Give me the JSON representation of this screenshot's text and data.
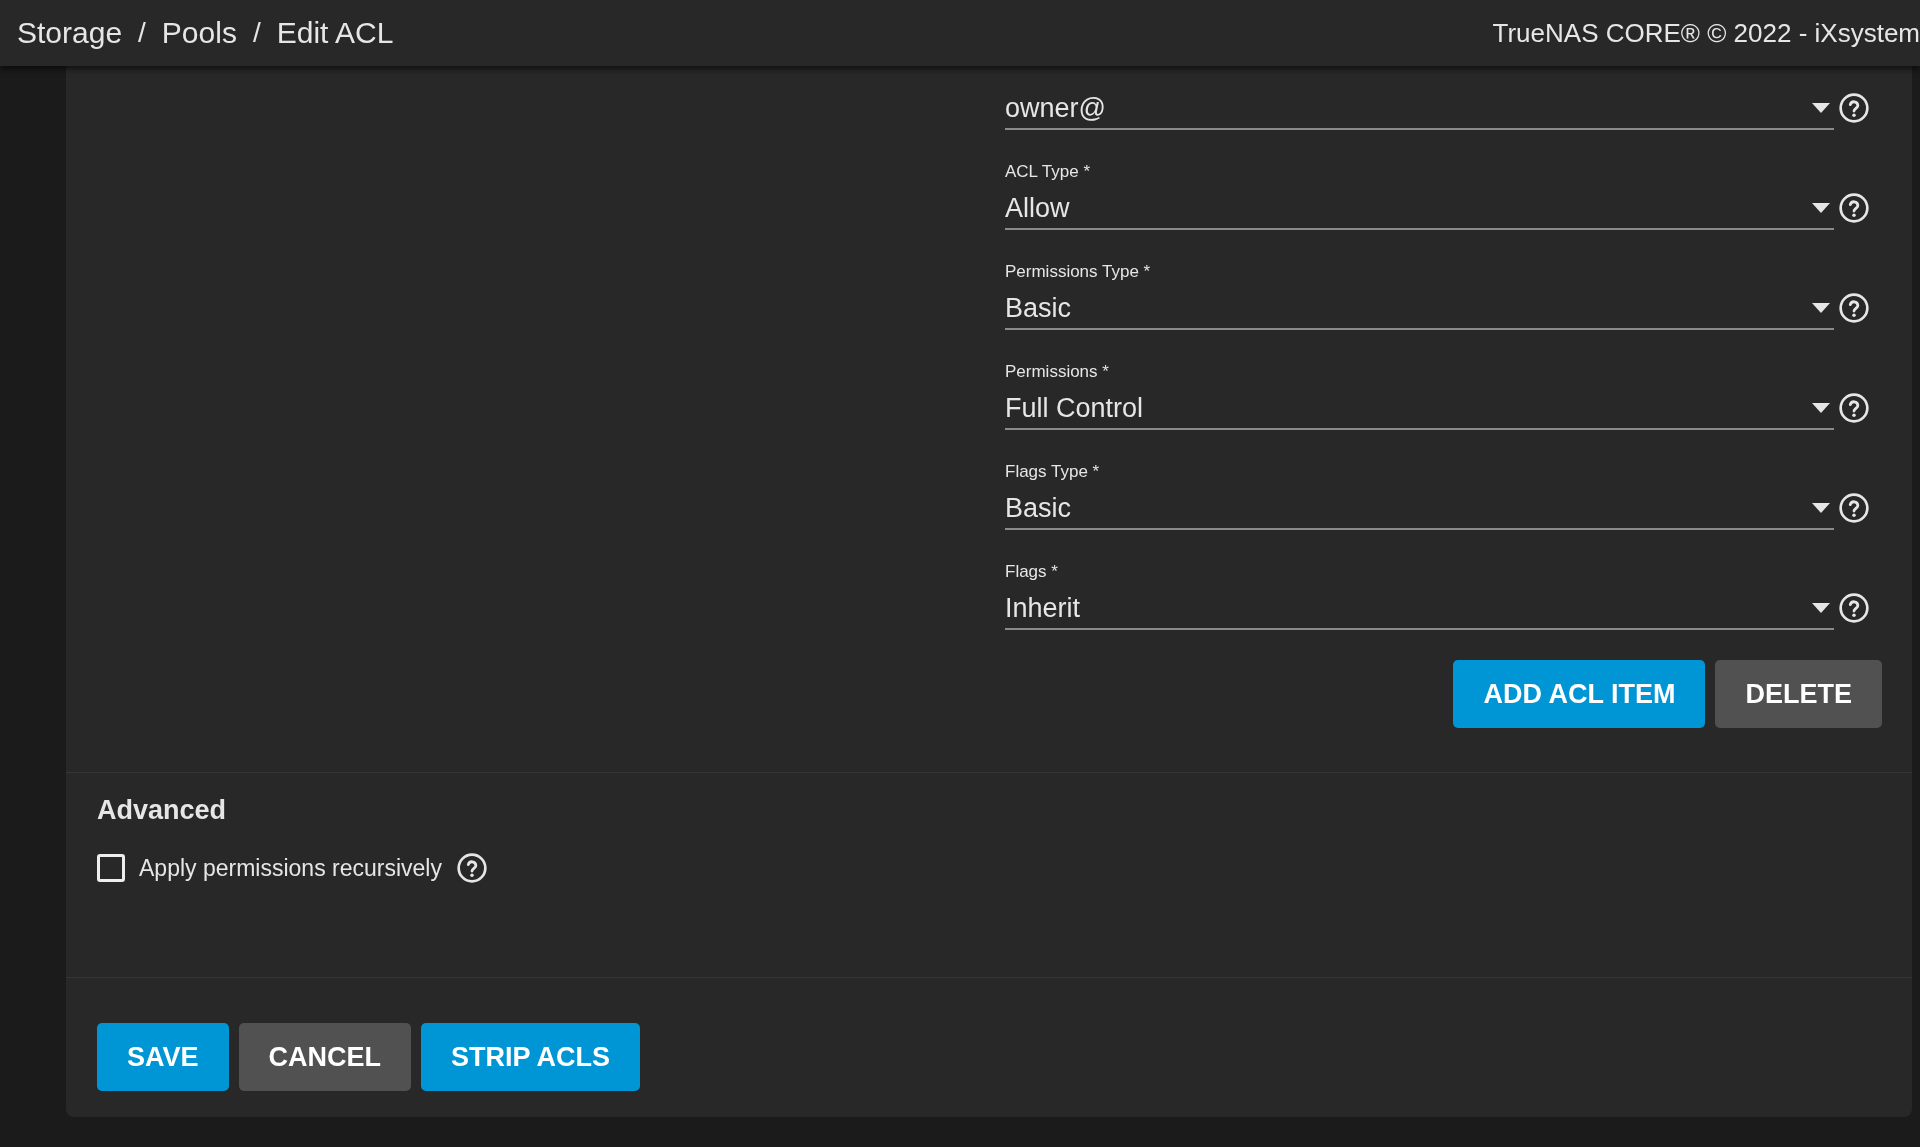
{
  "header": {
    "breadcrumb": [
      {
        "label": "Storage",
        "separator": "/"
      },
      {
        "label": "Pools",
        "separator": "/"
      },
      {
        "label": "Edit ACL"
      }
    ],
    "product": "TrueNAS CORE® © 2022 - iXsystem"
  },
  "acl_fields": [
    {
      "value": "owner@"
    },
    {
      "label": "ACL Type *",
      "value": "Allow"
    },
    {
      "label": "Permissions Type *",
      "value": "Basic"
    },
    {
      "label": "Permissions *",
      "value": "Full Control"
    },
    {
      "label": "Flags Type *",
      "value": "Basic"
    },
    {
      "label": "Flags *",
      "value": "Inherit"
    }
  ],
  "acl_buttons": [
    {
      "label": "ADD ACL ITEM",
      "kind": "primary"
    },
    {
      "label": "DELETE",
      "kind": "secondary"
    }
  ],
  "advanced": {
    "title": "Advanced",
    "recursive": {
      "label": "Apply permissions recursively",
      "checked": false
    }
  },
  "form_buttons": [
    {
      "label": "SAVE",
      "kind": "primary"
    },
    {
      "label": "CANCEL",
      "kind": "secondary"
    },
    {
      "label": "STRIP ACLS",
      "kind": "primary"
    }
  ]
}
